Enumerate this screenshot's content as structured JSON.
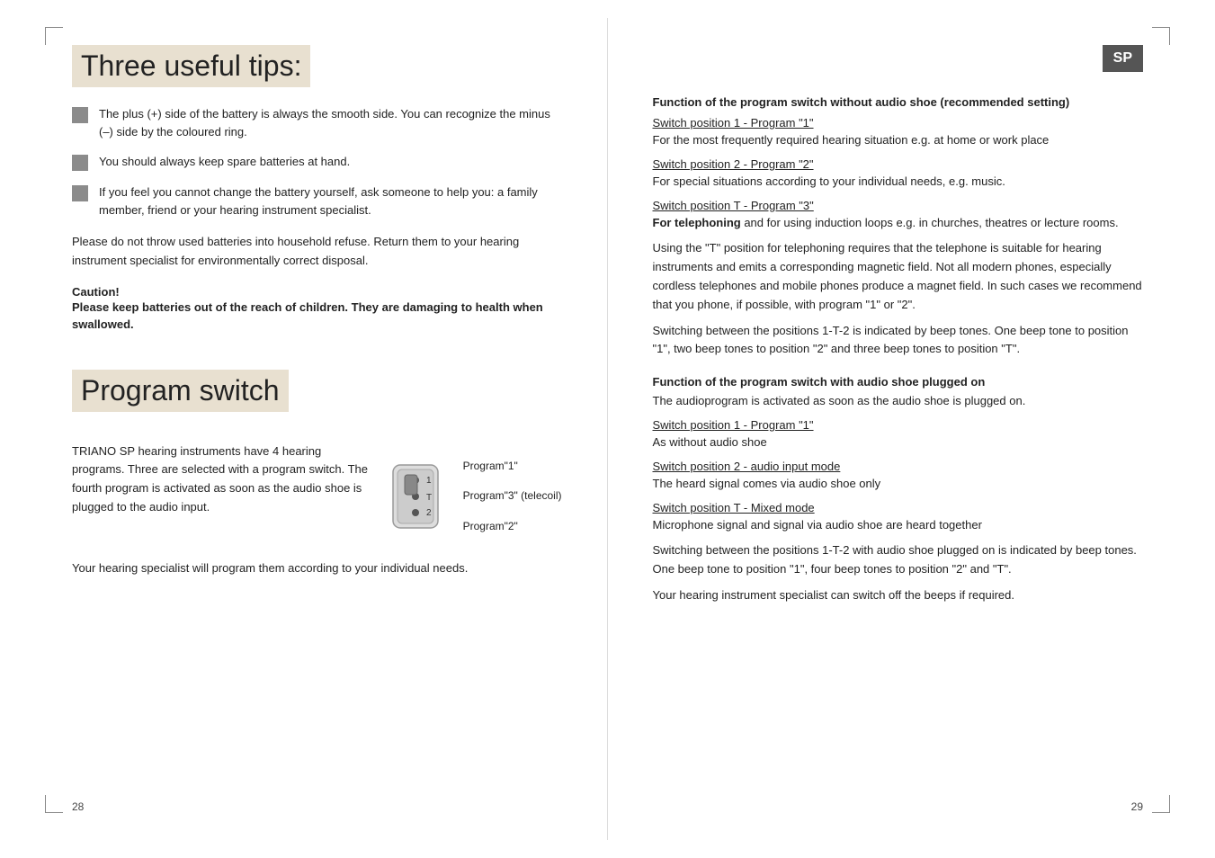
{
  "left_page": {
    "page_number": "28",
    "tips_title": "Three useful tips:",
    "tips": [
      {
        "text": "The plus (+) side of the battery is always the smooth side. You can recognize the minus (–) side by the coloured ring."
      },
      {
        "text": "You should always keep spare batteries at hand."
      },
      {
        "text": "If you feel you cannot change the battery yourself, ask someone to help you: a family member, friend or your hearing instrument specialist."
      }
    ],
    "battery_notice": "Please do not throw used batteries into household refuse. Return them to your hearing instrument specialist for environmentally correct disposal.",
    "caution_title": "Caution!",
    "caution_text": "Please keep batteries out of the reach of children. They are damaging to health when swallowed.",
    "program_title": "Program switch",
    "program_body": "TRIANO SP hearing instruments have 4 hearing programs. Three are selected with a program switch. The fourth program is activated as soon as the audio shoe is plugged to the audio input.",
    "program_footer": "Your hearing specialist will program them according to your individual needs.",
    "program_labels": {
      "label1": "Program\"1\"",
      "label3": "Program\"3\" (telecoil)",
      "label2": "Program\"2\""
    }
  },
  "right_page": {
    "page_number": "29",
    "sp_badge": "SP",
    "section1_heading": "Function of the program switch without audio shoe (recommended setting)",
    "switch1_label": "Switch position 1 - Program \"1\"",
    "switch1_text": "For the most frequently required hearing situation e.g. at home or work place",
    "switch2_label": "Switch position 2 - Program \"2\"",
    "switch2_text": "For special situations according to your individual needs, e.g. music.",
    "switchT_label": "Switch position T - Program \"3\"",
    "switchT_bold": "For telephoning",
    "switchT_text": " and for using induction loops e.g. in churches, theatres or lecture rooms.",
    "T_position_text": "Using the \"T\" position for telephoning requires that the telephone is suitable for hearing instruments and emits a corresponding magnetic field. Not all modern phones, especially cordless telephones and mobile phones produce a magnet field. In such cases we recommend that you phone, if possible, with program \"1\" or \"2\".",
    "beep_text1": "Switching between the positions 1-T-2 is indicated by beep tones. One beep tone to position \"1\", two beep tones to position \"2\" and three beep tones to position \"T\".",
    "section2_heading": "Function of the program switch with audio shoe plugged on",
    "audio_intro": "The audioprogram is activated as soon as the audio shoe is plugged on.",
    "switch_pos1_audio_label": "Switch position 1 - Program \"1\"",
    "switch_pos1_audio_text": "As without audio shoe",
    "switch_pos2_audio_label": "Switch position 2 - audio input mode",
    "switch_pos2_audio_text": "The heard signal comes via audio shoe only",
    "switch_posT_audio_label": "Switch position T - Mixed mode",
    "switch_posT_audio_text": "Microphone signal and signal via audio shoe are heard together",
    "beep_text2": "Switching between the positions 1-T-2 with audio shoe plugged on is indicated by beep tones. One beep tone to position \"1\", four beep tones to position \"2\" and \"T\".",
    "specialist_text": "Your hearing instrument specialist can switch off the beeps if required."
  }
}
